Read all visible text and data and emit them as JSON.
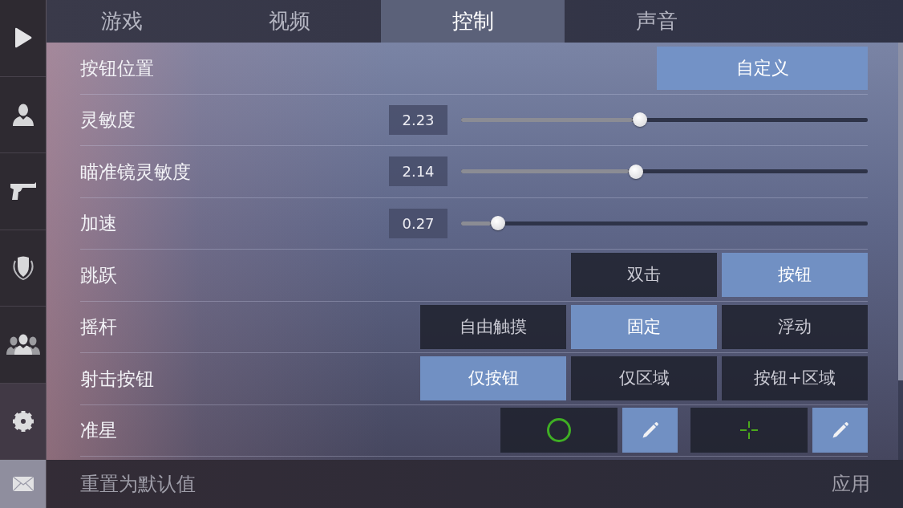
{
  "sidebar": {
    "items": [
      {
        "kind": "page",
        "selected": false
      },
      {
        "kind": "page",
        "selected": false
      },
      {
        "kind": "page",
        "selected": false
      },
      {
        "kind": "page",
        "selected": false
      },
      {
        "kind": "page",
        "selected": false
      },
      {
        "kind": "page",
        "selected": true
      },
      {
        "kind": "inbox",
        "selected": false
      }
    ]
  },
  "tabs": [
    {
      "label": "游戏",
      "selected": false
    },
    {
      "label": "视频",
      "selected": false
    },
    {
      "label": "控制",
      "selected": true
    },
    {
      "label": "声音",
      "selected": false
    }
  ],
  "settings": [
    {
      "kind": "button",
      "label": "按钮位置",
      "value": "自定义"
    },
    {
      "kind": "slider",
      "label": "灵敏度",
      "reading": "2.23",
      "level": 0.44
    },
    {
      "kind": "slider",
      "label": "瞄准镜灵敏度",
      "reading": "2.14",
      "level": 0.43
    },
    {
      "kind": "slider",
      "label": "加速",
      "reading": "0.27",
      "level": 0.09
    },
    {
      "kind": "choice",
      "label": "跳跃",
      "options": [
        {
          "label": "双击",
          "selected": false
        },
        {
          "label": "按钮",
          "selected": true
        }
      ]
    },
    {
      "kind": "choice",
      "label": "摇杆",
      "options": [
        {
          "label": "自由触摸",
          "selected": false
        },
        {
          "label": "固定",
          "selected": true
        },
        {
          "label": "浮动",
          "selected": false
        }
      ]
    },
    {
      "kind": "choice",
      "label": "射击按钮",
      "options": [
        {
          "label": "仅按钮",
          "selected": true
        },
        {
          "label": "仅区域",
          "selected": false
        },
        {
          "label": "按钮+区域",
          "selected": false
        }
      ]
    },
    {
      "kind": "crosshair",
      "label": "准星",
      "crosshairs": [
        {
          "kind": "circle"
        },
        {
          "kind": "cross"
        }
      ]
    }
  ],
  "footer": {
    "reset": "重置为默认值",
    "apply": "应用"
  }
}
